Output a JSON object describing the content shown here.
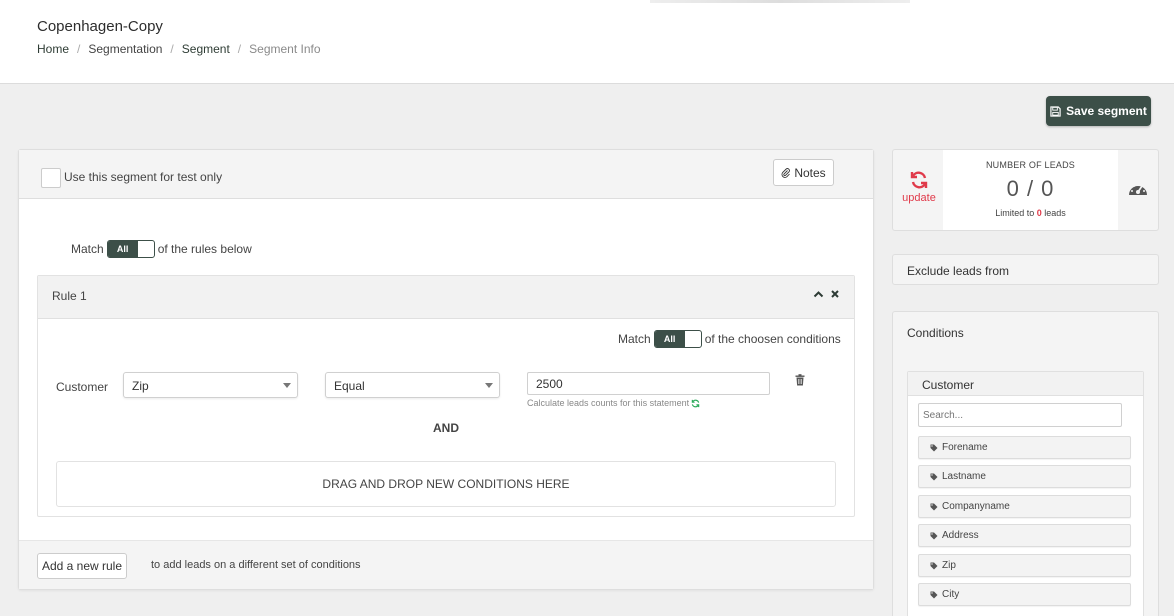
{
  "header": {
    "title": "Copenhagen-Copy",
    "breadcrumb": [
      "Home",
      "Segmentation",
      "Segment",
      "Segment Info"
    ]
  },
  "toolbar": {
    "save_label": "Save segment"
  },
  "main": {
    "test_only_label": "Use this segment for test only",
    "notes_label": "Notes",
    "match_prefix": "Match",
    "match_toggle": "All",
    "match_suffix": "of the rules below",
    "rule": {
      "title": "Rule 1",
      "match_prefix": "Match",
      "match_toggle": "All",
      "match_suffix": "of the choosen conditions",
      "condition": {
        "entity": "Customer",
        "field": "Zip",
        "operator": "Equal",
        "value": "2500",
        "calc_hint": "Calculate leads counts for this statement"
      },
      "and_label": "AND",
      "dropzone_label": "DRAG AND DROP NEW CONDITIONS HERE"
    },
    "add_rule_label": "Add a new rule",
    "add_rule_hint": "to add leads on a different set of conditions"
  },
  "leads": {
    "update_label": "update",
    "title": "NUMBER OF LEADS",
    "count": "0 / 0",
    "limit_prefix": "Limited to",
    "limit_value": "0",
    "limit_suffix": "leads"
  },
  "exclude": {
    "label": "Exclude leads from"
  },
  "conditions": {
    "title": "Conditions",
    "group": "Customer",
    "search_placeholder": "Search...",
    "fields": [
      "Forename",
      "Lastname",
      "Companyname",
      "Address",
      "Zip",
      "City"
    ]
  },
  "colors": {
    "accent": "#3c4f48",
    "alert": "#e03a4a",
    "refresh": "#2aaa5a"
  }
}
